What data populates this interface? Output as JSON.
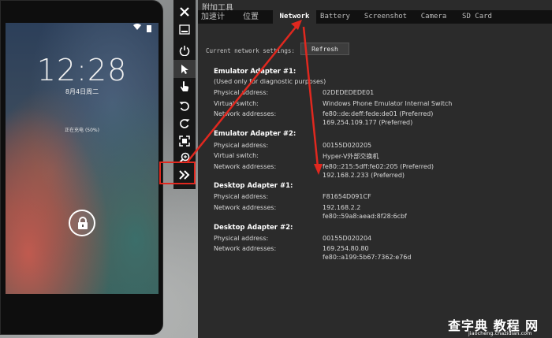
{
  "phone": {
    "clock": "12:28",
    "date": "8月4日周二",
    "charging": "正在充电 (50%)"
  },
  "toolbar": {
    "buttons": [
      {
        "name": "close-icon"
      },
      {
        "name": "minimize-icon"
      },
      {
        "name": "power-icon"
      },
      {
        "name": "pointer-icon"
      },
      {
        "name": "touch-icon"
      },
      {
        "name": "rotate-left-icon"
      },
      {
        "name": "rotate-right-icon"
      },
      {
        "name": "fit-to-screen-icon"
      },
      {
        "name": "zoom-icon"
      },
      {
        "name": "expand-tools-icon"
      }
    ]
  },
  "panel": {
    "title": "附加工具",
    "tabs": [
      {
        "label": "加速计"
      },
      {
        "label": "位置"
      },
      {
        "label": "Network"
      },
      {
        "label": "Battery"
      },
      {
        "label": "Screenshot"
      },
      {
        "label": "Camera"
      },
      {
        "label": "SD Card"
      }
    ],
    "active_tab": "Network",
    "settings_label": "Current network settings:",
    "refresh_label": "Refresh",
    "physical_address_label": "Physical address:",
    "virtual_switch_label": "Virtual switch:",
    "network_addresses_label": "Network addresses:",
    "adapters": [
      {
        "title": "Emulator Adapter #1:",
        "note": "(Used only for diagnostic purposes)",
        "physical_address": "02DEDEDEDE01",
        "virtual_switch": "Windows Phone Emulator Internal Switch",
        "network_addresses": [
          "fe80::de:deff:fede:de01 (Preferred)",
          "169.254.109.177 (Preferred)"
        ]
      },
      {
        "title": "Emulator Adapter #2:",
        "physical_address": "00155D020205",
        "virtual_switch": "Hyper-V外部交换机",
        "network_addresses": [
          "fe80::215:5dff:fe02:205 (Preferred)",
          "192.168.2.233 (Preferred)"
        ]
      },
      {
        "title": "Desktop Adapter #1:",
        "physical_address": "F81654D091CF",
        "network_addresses": [
          "192.168.2.2",
          "fe80::59a8:aead:8f28:6cbf"
        ]
      },
      {
        "title": "Desktop Adapter #2:",
        "physical_address": "00155D020204",
        "network_addresses": [
          "169.254.80.80",
          "fe80::a199:5b67:7362:e76d"
        ]
      }
    ]
  },
  "watermark": {
    "text": "查字典 教程 网",
    "url": "jiaocheng.chazidian.com"
  },
  "colors": {
    "annotation": "#e0281f",
    "panel_bg": "#2b2b2b",
    "tabbar_bg": "#111111"
  }
}
